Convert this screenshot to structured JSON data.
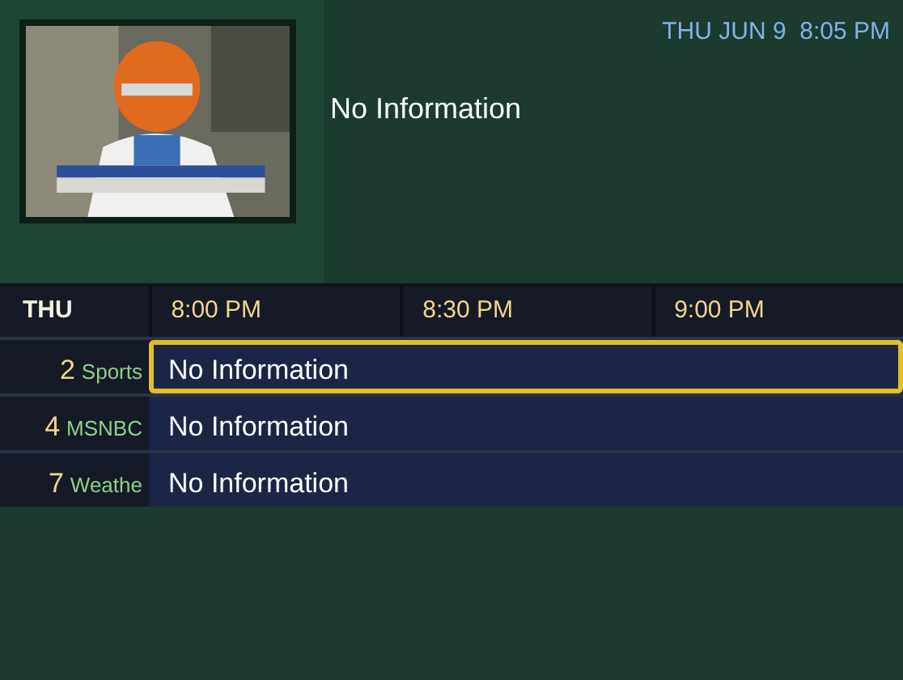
{
  "info": {
    "title": "No Information",
    "clock": "THU JUN 9  8:05 PM"
  },
  "guide": {
    "day": "THU",
    "times": [
      "8:00 PM",
      "8:30 PM",
      "9:00 PM"
    ],
    "channels": [
      {
        "number": "2",
        "name": "Sports",
        "program": "No Information",
        "selected": true
      },
      {
        "number": "4",
        "name": "MSNBC",
        "program": "No Information",
        "selected": false
      },
      {
        "number": "7",
        "name": "Weathe",
        "program": "No Information",
        "selected": false
      }
    ]
  }
}
